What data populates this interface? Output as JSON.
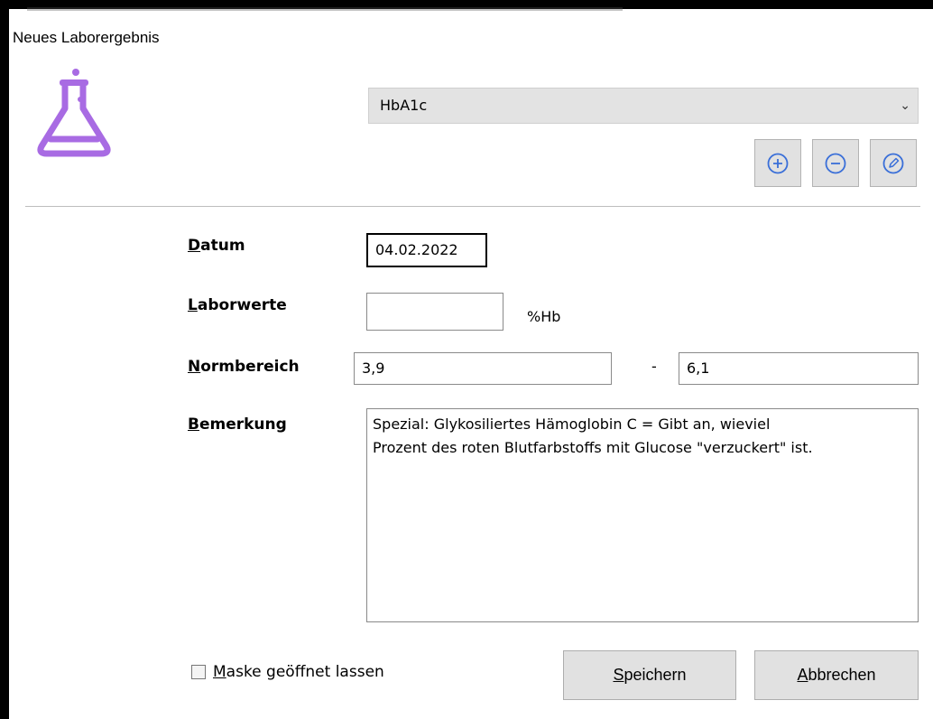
{
  "window": {
    "title": "Neues Laborergebnis"
  },
  "header": {
    "icon": "flask-icon",
    "accent_color": "#a86be3"
  },
  "lab_select": {
    "selected": "HbA1c"
  },
  "toolbar": {
    "add_icon": "plus-circle-icon",
    "remove_icon": "minus-circle-icon",
    "edit_icon": "pencil-icon",
    "icon_color": "#3a6fd8"
  },
  "form": {
    "datum": {
      "label_mnemonic": "D",
      "label_rest": "atum",
      "value": "04.02.2022"
    },
    "laborwerte": {
      "label_mnemonic": "L",
      "label_rest": "aborwerte",
      "value": "",
      "unit": "%Hb"
    },
    "normbereich": {
      "label_mnemonic": "N",
      "label_rest": "ormbereich",
      "min": "3,9",
      "separator": "-",
      "max": "6,1"
    },
    "bemerkung": {
      "label_mnemonic": "B",
      "label_rest": "emerkung",
      "value": "Spezial: Glykosiliertes Hämoglobin C = Gibt an, wieviel\nProzent des roten Blutfarbstoffs mit Glucose \"verzuckert\" ist."
    }
  },
  "footer": {
    "keep_open": {
      "mnemonic": "M",
      "rest": "aske geöffnet lassen",
      "checked": false
    },
    "save": {
      "mnemonic": "S",
      "rest": "peichern"
    },
    "cancel": {
      "mnemonic": "A",
      "rest": "bbrechen"
    }
  }
}
